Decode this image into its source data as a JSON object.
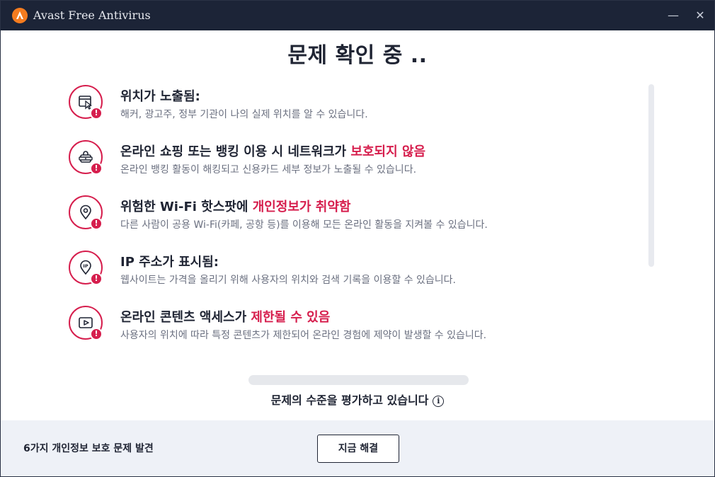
{
  "window": {
    "title": "Avast Free Antivirus",
    "minimize": "—",
    "close": "✕"
  },
  "heading": "문제 확인 중 ..",
  "issues": [
    {
      "icon": "browser-cursor-icon",
      "title": "위치가 노출됨:",
      "title_accent": "",
      "desc": "해커, 광고주, 정부 기관이 나의 실제 위치를 알 수 있습니다.",
      "badge": "!"
    },
    {
      "icon": "shopping-bag-icon",
      "title": "온라인 쇼핑 또는 뱅킹 이용 시 네트워크가 ",
      "title_accent": "보호되지 않음",
      "desc": "온라인 뱅킹 활동이 해킹되고 신용카드 세부 정보가 노출될 수 있습니다.",
      "badge": "!"
    },
    {
      "icon": "location-pin-icon",
      "title": "위험한 Wi-Fi 핫스팟에 ",
      "title_accent": "개인정보가 취약함",
      "desc": "다른 사람이 공용 Wi-Fi(카페, 공항 등)를 이용해 모든 온라인 활동을 지켜볼 수 있습니다.",
      "badge": "!"
    },
    {
      "icon": "ip-pin-icon",
      "title": "IP 주소가 표시됨:",
      "title_accent": "",
      "desc": "웹사이트는 가격을 올리기 위해 사용자의 위치와 검색 기록을 이용할 수 있습니다.",
      "badge": "!"
    },
    {
      "icon": "video-play-icon",
      "title": "온라인 콘텐츠 액세스가 ",
      "title_accent": "제한될 수 있음",
      "desc": "사용자의 위치에 따라 특정 콘텐츠가 제한되어 온라인 경험에 제약이 발생할 수 있습니다.",
      "badge": "!"
    }
  ],
  "progress": {
    "label": "문제의 수준을 평가하고 있습니다",
    "info": "i",
    "value": 0
  },
  "footer": {
    "summary": "6가지 개인정보 보호 문제 발견",
    "fix_button": "지금 해결"
  },
  "colors": {
    "accent": "#d61e4d",
    "titlebar": "#1c2437",
    "footer": "#eef1f7",
    "logo": "#f57c1f"
  }
}
